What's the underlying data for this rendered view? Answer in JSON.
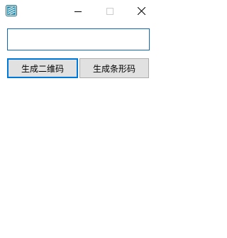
{
  "window": {
    "icon": "qr-app-icon",
    "minimize_icon": "minimize-icon",
    "maximize_icon": "maximize-icon",
    "close_icon": "close-icon"
  },
  "input": {
    "value": "",
    "placeholder": ""
  },
  "buttons": {
    "qr_label": "生成二维码",
    "barcode_label": "生成条形码"
  },
  "colors": {
    "focus_border": "#0078d7",
    "input_border": "#0f69b8",
    "button_face": "#e1e1e1",
    "button_border": "#adadad"
  }
}
